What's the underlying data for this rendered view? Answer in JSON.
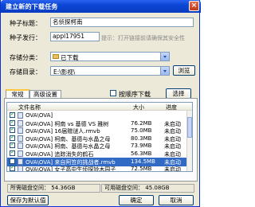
{
  "window": {
    "title": "建立新的下载任务",
    "close_glyph": "×"
  },
  "form": {
    "seed_title_label": "种子标题：",
    "seed_title_value": "名侦探柯南",
    "seed_publisher_label": "种子发行：",
    "seed_publisher_value": "appl17951",
    "hint": "提示：打开链接前请确保其安全性",
    "category_label": "存储分类：",
    "category_value": "已下载",
    "directory_label": "存储目录：",
    "directory_value": "E:\\影视\\",
    "browse_button": "浏览"
  },
  "tabs": [
    "常规",
    "高级设置"
  ],
  "options": {
    "sort_by_type": "按顺序下载",
    "select_button": "选择"
  },
  "file_list": {
    "columns": [
      "文件名称",
      "大小",
      "进度"
    ],
    "rows": [
      {
        "name": "OVA\\OVA]",
        "size": "",
        "progress": "",
        "checked": true,
        "selected": false
      },
      {
        "name": "OVA\\OVA] 柯南 vs 基德 VS 雅树",
        "size": "76.2MB",
        "progress": "未启动",
        "checked": true,
        "selected": false
      },
      {
        "name": "OVA\\OVA] 16届赠谜人.rmvb",
        "size": "75.0MB",
        "progress": "未启动",
        "checked": true,
        "selected": false
      },
      {
        "name": "OVA\\OVA] 柯南、基德与水晶之母",
        "size": "80.3MB",
        "progress": "未启动",
        "checked": true,
        "selected": false
      },
      {
        "name": "OVA\\OVA] 柯南、基德与水晶之母",
        "size": "73.9MB",
        "progress": "未启动",
        "checked": true,
        "selected": false
      },
      {
        "name": "OVA\\OVA] 追踪消失的鹤石",
        "size": "56.3MB",
        "progress": "未启动",
        "checked": true,
        "selected": false
      },
      {
        "name": "OVA\\OVA] 来自阿笠的挑战者.rmvb",
        "size": "134.5MB",
        "progress": "未启动",
        "checked": false,
        "selected": true
      },
      {
        "name": "OVA\\OVA] 女子高中生侦探铃木园子",
        "size": "72.5MB",
        "progress": "未启动",
        "checked": true,
        "selected": false
      }
    ]
  },
  "status": {
    "disk_space_label": "所需磁盘空间：",
    "disk_space_value": "54.36GB",
    "available_label": "可用磁盘空间：",
    "available_value": "45.08GB"
  },
  "footer": {
    "save_default": "保存为默认值",
    "ok": "确定",
    "cancel": "取消"
  }
}
